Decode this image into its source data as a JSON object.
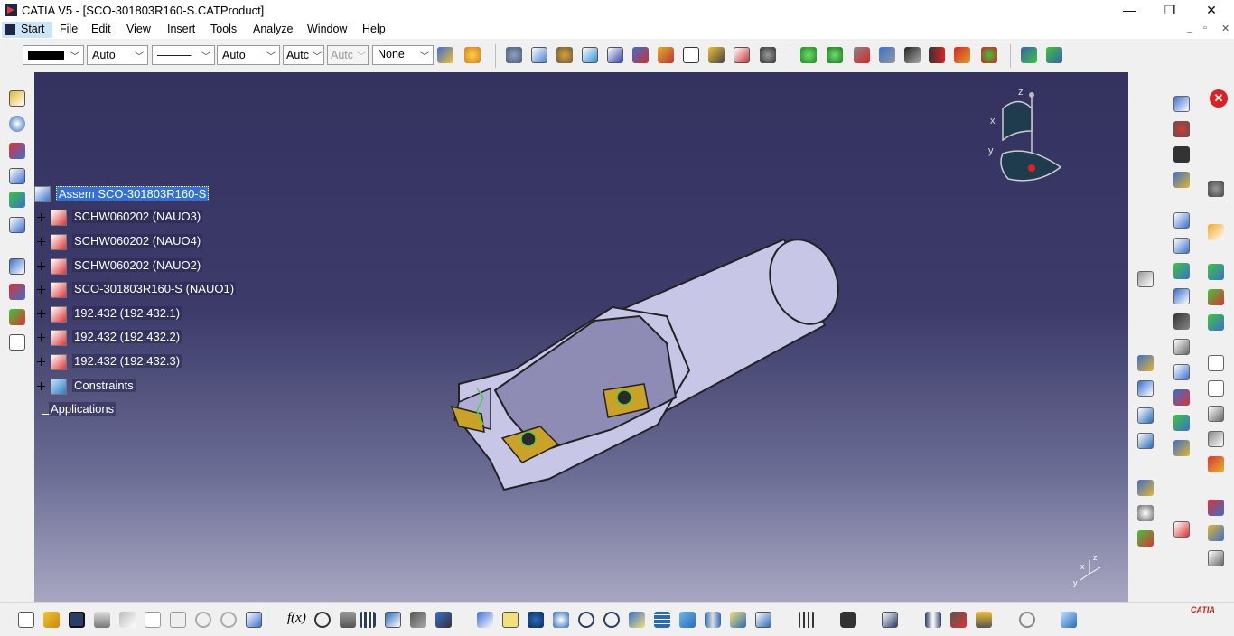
{
  "window": {
    "title": "CATIA V5 - [SCO-301803R160-S.CATProduct]",
    "controls": {
      "minimize": "—",
      "maximize": "❐",
      "close": "✕"
    }
  },
  "menu": {
    "start": "Start",
    "items": [
      "File",
      "Edit",
      "View",
      "Insert",
      "Tools",
      "Analyze",
      "Window",
      "Help"
    ],
    "mdi_controls": {
      "minimize": "_",
      "restore": "▫",
      "close": "✕"
    }
  },
  "properties_toolbar": {
    "color_swatch": "#000000",
    "combos": [
      {
        "name": "color",
        "value": ""
      },
      {
        "name": "transparency",
        "value": "Auto"
      },
      {
        "name": "linetype",
        "value": "———"
      },
      {
        "name": "thickness",
        "value": "Auto"
      },
      {
        "name": "point-symbol",
        "value": "Autc"
      },
      {
        "name": "layer-auto",
        "value": "Autc"
      },
      {
        "name": "layer",
        "value": "None"
      }
    ]
  },
  "tree": {
    "root": "Assem SCO-301803R160-S",
    "children": [
      "SCHW060202 (NAUO3)",
      "SCHW060202 (NAUO4)",
      "SCHW060202 (NAUO2)",
      "SCO-301803R160-S (NAUO1)",
      "192.432 (192.432.1)",
      "192.432 (192.432.2)",
      "192.432 (192.432.3)",
      "Constraints"
    ],
    "applications": "Applications"
  },
  "compass": {
    "x": "x",
    "y": "y",
    "z": "z"
  },
  "mini_axis": {
    "x": "x",
    "y": "y",
    "z": "z"
  },
  "brand": "CATIA",
  "colors": {
    "viewport_top": "#34325f",
    "viewport_bottom": "#a7a7c2",
    "part_body": "#c8c6e6",
    "insert": "#c9a227",
    "tree_selection": "#3372d4"
  }
}
